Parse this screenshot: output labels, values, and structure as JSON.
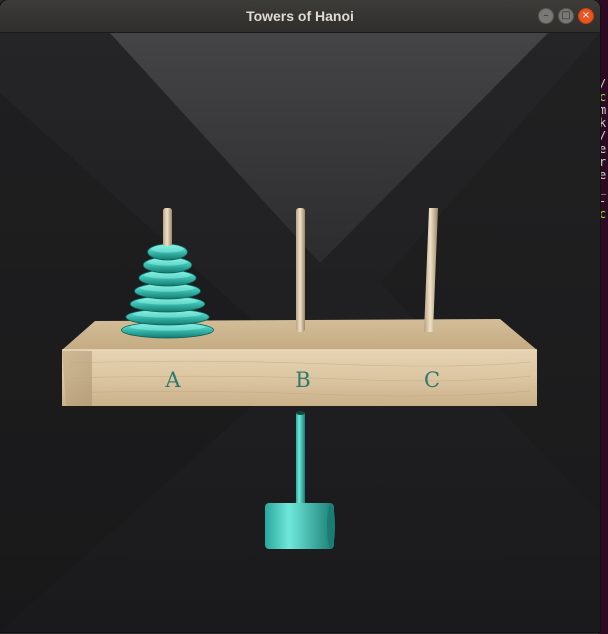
{
  "window": {
    "title": "Towers of Hanoi",
    "buttons": {
      "minimize": "–",
      "maximize": "□",
      "close": "×"
    }
  },
  "game": {
    "pegs": [
      {
        "label": "A",
        "disks": 7
      },
      {
        "label": "B",
        "disks": 0
      },
      {
        "label": "C",
        "disks": 0
      }
    ],
    "held_disks": 0,
    "colors": {
      "disk": "#48d1c3",
      "base_wood": "#d9c4a0",
      "background": "#1f1f21"
    }
  }
}
